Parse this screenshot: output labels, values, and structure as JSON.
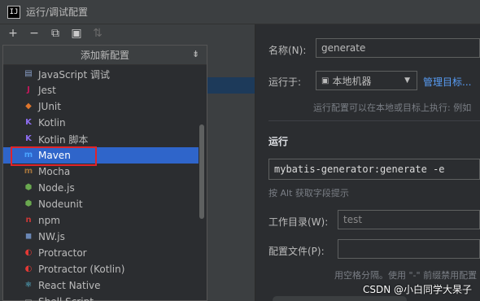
{
  "window": {
    "title": "运行/调试配置",
    "app_icon": "IJ"
  },
  "toolbar": {
    "buttons": [
      {
        "name": "add-icon",
        "glyph": "+"
      },
      {
        "name": "remove-icon",
        "glyph": "−"
      },
      {
        "name": "copy-icon",
        "glyph": "⧉"
      },
      {
        "name": "folder-add-icon",
        "glyph": "▣"
      },
      {
        "name": "sort-icon",
        "glyph": "⇅"
      }
    ]
  },
  "popup": {
    "title": "添加新配置",
    "collapse_glyph": "⇟",
    "items": [
      {
        "label": "JavaScript 调试",
        "icon": "javascript-debug-icon",
        "glyph": "▤",
        "color": "#8aa0c8"
      },
      {
        "label": "Jest",
        "icon": "jest-icon",
        "glyph": "J",
        "color": "#c2185b"
      },
      {
        "label": "JUnit",
        "icon": "junit-icon",
        "glyph": "◆",
        "color": "#e0762c"
      },
      {
        "label": "Kotlin",
        "icon": "kotlin-icon",
        "glyph": "K",
        "color": "#8f6ef2"
      },
      {
        "label": "Kotlin 脚本",
        "icon": "kotlin-script-icon",
        "glyph": "K",
        "color": "#8f6ef2"
      },
      {
        "label": "Maven",
        "icon": "maven-icon",
        "glyph": "m",
        "color": "#4aa3ff"
      },
      {
        "label": "Mocha",
        "icon": "mocha-icon",
        "glyph": "m",
        "color": "#a0723c"
      },
      {
        "label": "Node.js",
        "icon": "nodejs-icon",
        "glyph": "⬢",
        "color": "#6aa84f"
      },
      {
        "label": "Nodeunit",
        "icon": "nodeunit-icon",
        "glyph": "⬢",
        "color": "#6aa84f"
      },
      {
        "label": "npm",
        "icon": "npm-icon",
        "glyph": "n",
        "color": "#cb3837"
      },
      {
        "label": "NW.js",
        "icon": "nwjs-icon",
        "glyph": "◼",
        "color": "#6a87b5"
      },
      {
        "label": "Protractor",
        "icon": "protractor-icon",
        "glyph": "◐",
        "color": "#e53935"
      },
      {
        "label": "Protractor (Kotlin)",
        "icon": "protractor-kotlin-icon",
        "glyph": "◐",
        "color": "#e53935"
      },
      {
        "label": "React Native",
        "icon": "react-native-icon",
        "glyph": "⚛",
        "color": "#61dafb"
      },
      {
        "label": "Shell Script",
        "icon": "shell-script-icon",
        "glyph": "▭",
        "color": "#9e9e9e"
      }
    ],
    "selected_index": 5
  },
  "form": {
    "name_label": "名称(N):",
    "name_value": "generate",
    "run_on_label": "运行于:",
    "run_on_value": "本地机器",
    "run_on_icon": "computer-icon",
    "manage_targets_link": "管理目标...",
    "run_on_hint": "运行配置可以在本地或目标上执行: 例如",
    "section_run": "运行",
    "command_value": "mybatis-generator:generate -e",
    "command_hint": "按 Alt 获取字段提示",
    "workdir_label": "工作目录(W):",
    "workdir_value": "test",
    "profiles_label": "配置文件(P):",
    "profiles_value": "",
    "profiles_hint": "用空格分隔。使用 \"-\" 前缀禁用配置"
  },
  "watermark": "CSDN @小白同学大杲子"
}
